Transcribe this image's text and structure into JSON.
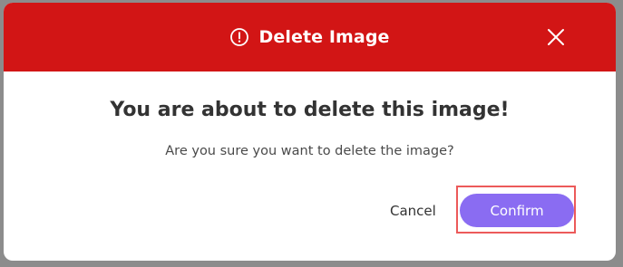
{
  "dialog": {
    "header_title": "Delete Image",
    "header_icon": "alert-circle-icon",
    "close_icon": "close-icon",
    "title": "You are about to delete this image!",
    "message": "Are you sure you want to delete the image?",
    "cancel_label": "Cancel",
    "confirm_label": "Confirm"
  },
  "colors": {
    "header_bg": "#d21515",
    "confirm_bg": "#8a6cf2",
    "highlight_border": "#ec5a5a"
  }
}
